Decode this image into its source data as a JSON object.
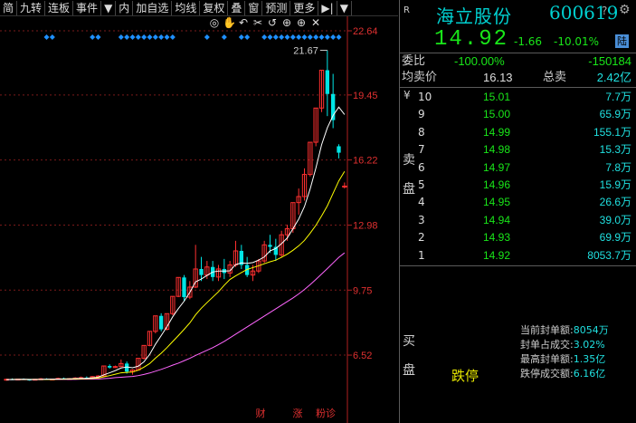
{
  "toolbar": {
    "items": [
      "简",
      "九转",
      "连板",
      "事件",
      "▼",
      "内",
      "加自选",
      "均线",
      "复权",
      "叠",
      "窗",
      "预测",
      "更多",
      "▶|",
      "▼"
    ]
  },
  "chart_tools": [
    "◎",
    "✋",
    "↶",
    "✂",
    "↺",
    "⊕",
    "⊕",
    "✕"
  ],
  "chart_data": {
    "type": "candlestick",
    "y_axis_ticks": [
      "22.64",
      "19.45",
      "16.22",
      "12.98",
      "9.75",
      "6.52"
    ],
    "ylim": [
      4.0,
      22.64
    ],
    "high_label": "21.67",
    "bottom_marks": [
      "财",
      "涨",
      "粉诊"
    ],
    "colors": {
      "up": "#ff3030",
      "down": "#00e5e5",
      "ma5": "#ffffff",
      "ma10": "#ffff00",
      "ma20": "#ff66ff",
      "signal": "#1e90ff"
    },
    "candles": [
      [
        5.3,
        5.35,
        5.25,
        5.32
      ],
      [
        5.32,
        5.36,
        5.28,
        5.3
      ],
      [
        5.3,
        5.34,
        5.26,
        5.33
      ],
      [
        5.33,
        5.36,
        5.29,
        5.3
      ],
      [
        5.3,
        5.33,
        5.25,
        5.28
      ],
      [
        5.28,
        5.34,
        5.27,
        5.32
      ],
      [
        5.32,
        5.38,
        5.3,
        5.34
      ],
      [
        5.34,
        5.37,
        5.3,
        5.31
      ],
      [
        5.31,
        5.35,
        5.28,
        5.33
      ],
      [
        5.33,
        5.4,
        5.32,
        5.36
      ],
      [
        5.36,
        5.4,
        5.31,
        5.33
      ],
      [
        5.33,
        5.38,
        5.3,
        5.35
      ],
      [
        5.35,
        5.42,
        5.33,
        5.38
      ],
      [
        5.38,
        5.45,
        5.36,
        5.4
      ],
      [
        5.4,
        5.46,
        5.37,
        5.39
      ],
      [
        5.39,
        5.48,
        5.38,
        5.45
      ],
      [
        5.45,
        5.52,
        5.43,
        5.48
      ],
      [
        5.48,
        5.98,
        5.47,
        5.98
      ],
      [
        5.98,
        6.06,
        5.85,
        5.9
      ],
      [
        5.9,
        6.0,
        5.88,
        5.95
      ],
      [
        5.95,
        6.3,
        5.93,
        6.1
      ],
      [
        6.1,
        6.2,
        5.6,
        5.7
      ],
      [
        5.7,
        5.82,
        5.55,
        5.78
      ],
      [
        5.78,
        6.36,
        5.76,
        6.36
      ],
      [
        6.36,
        7.0,
        6.3,
        7.0
      ],
      [
        7.0,
        7.7,
        6.96,
        7.7
      ],
      [
        7.7,
        8.47,
        7.6,
        8.47
      ],
      [
        8.47,
        8.6,
        7.7,
        7.8
      ],
      [
        7.8,
        8.58,
        7.75,
        8.58
      ],
      [
        8.58,
        9.44,
        8.5,
        9.44
      ],
      [
        9.44,
        10.38,
        9.4,
        10.38
      ],
      [
        10.38,
        10.5,
        9.2,
        9.4
      ],
      [
        9.4,
        10.2,
        9.3,
        9.9
      ],
      [
        9.9,
        12.0,
        9.85,
        10.8
      ],
      [
        10.8,
        11.4,
        10.2,
        10.5
      ],
      [
        10.5,
        11.2,
        10.3,
        10.9
      ],
      [
        10.9,
        11.2,
        10.2,
        10.4
      ],
      [
        10.4,
        11.0,
        10.2,
        10.8
      ],
      [
        10.8,
        11.3,
        10.3,
        10.6
      ],
      [
        10.6,
        11.2,
        10.4,
        11.0
      ],
      [
        11.0,
        12.2,
        10.9,
        11.7
      ],
      [
        11.7,
        12.0,
        10.8,
        11.0
      ],
      [
        11.0,
        11.4,
        10.4,
        10.5
      ],
      [
        10.5,
        11.0,
        10.2,
        10.7
      ],
      [
        10.7,
        11.3,
        10.6,
        11.2
      ],
      [
        11.2,
        12.2,
        11.1,
        12.0
      ],
      [
        12.0,
        12.5,
        11.6,
        11.9
      ],
      [
        11.9,
        12.3,
        11.2,
        11.5
      ],
      [
        11.5,
        12.7,
        11.4,
        12.5
      ],
      [
        12.5,
        13.0,
        12.2,
        12.8
      ],
      [
        12.8,
        14.1,
        12.6,
        14.1
      ],
      [
        14.1,
        14.8,
        13.5,
        14.4
      ],
      [
        14.4,
        15.8,
        14.2,
        15.5
      ],
      [
        15.5,
        17.1,
        15.4,
        17.1
      ],
      [
        17.1,
        18.8,
        16.9,
        18.8
      ],
      [
        18.8,
        20.68,
        18.6,
        20.68
      ],
      [
        20.68,
        21.67,
        18.4,
        19.5
      ],
      [
        19.5,
        20.5,
        17.8,
        18.2
      ],
      [
        16.9,
        17.0,
        16.3,
        16.58
      ],
      [
        14.92,
        15.1,
        14.8,
        14.92
      ]
    ],
    "ma5": [
      5.3,
      5.31,
      5.31,
      5.32,
      5.31,
      5.31,
      5.31,
      5.32,
      5.32,
      5.33,
      5.34,
      5.34,
      5.35,
      5.36,
      5.37,
      5.39,
      5.42,
      5.54,
      5.64,
      5.75,
      5.88,
      5.93,
      5.89,
      5.97,
      6.19,
      6.56,
      7.06,
      7.49,
      7.93,
      8.42,
      8.83,
      9.2,
      9.64,
      10.16,
      10.3,
      10.48,
      10.65,
      10.7,
      10.7,
      10.71,
      11.02,
      11.1,
      11.08,
      11.12,
      11.24,
      11.4,
      11.7,
      11.82,
      12.06,
      12.34,
      12.8,
      13.28,
      13.9,
      14.78,
      15.82,
      16.98,
      17.82,
      18.43,
      18.85,
      18.48
    ],
    "ma10": [
      5.3,
      5.31,
      5.31,
      5.31,
      5.31,
      5.31,
      5.31,
      5.31,
      5.31,
      5.32,
      5.32,
      5.33,
      5.33,
      5.34,
      5.35,
      5.36,
      5.38,
      5.44,
      5.5,
      5.57,
      5.64,
      5.66,
      5.68,
      5.77,
      5.92,
      6.1,
      6.37,
      6.61,
      6.89,
      7.19,
      7.49,
      7.8,
      8.12,
      8.52,
      8.85,
      9.13,
      9.4,
      9.67,
      9.99,
      10.28,
      10.46,
      10.62,
      10.78,
      10.87,
      10.96,
      11.06,
      11.16,
      11.24,
      11.38,
      11.54,
      11.73,
      11.95,
      12.22,
      12.58,
      12.97,
      13.44,
      13.94,
      14.56,
      15.18,
      15.65
    ],
    "ma20": [
      5.3,
      5.3,
      5.3,
      5.3,
      5.3,
      5.3,
      5.31,
      5.31,
      5.31,
      5.31,
      5.31,
      5.31,
      5.31,
      5.32,
      5.32,
      5.32,
      5.33,
      5.35,
      5.37,
      5.4,
      5.42,
      5.44,
      5.46,
      5.5,
      5.56,
      5.63,
      5.72,
      5.81,
      5.91,
      6.02,
      6.12,
      6.24,
      6.36,
      6.5,
      6.63,
      6.76,
      6.89,
      7.04,
      7.2,
      7.38,
      7.56,
      7.74,
      7.92,
      8.1,
      8.28,
      8.46,
      8.64,
      8.82,
      9.0,
      9.18,
      9.36,
      9.56,
      9.78,
      10.02,
      10.28,
      10.55,
      10.82,
      11.1,
      11.38,
      11.6
    ],
    "signal_indices": [
      7,
      8,
      15,
      16,
      20,
      21,
      22,
      23,
      24,
      25,
      26,
      27,
      28,
      29,
      35,
      38,
      41,
      42,
      45,
      46,
      47,
      48,
      49,
      50,
      51,
      52,
      53,
      54,
      55,
      56,
      57,
      58
    ]
  },
  "stock": {
    "badge": "R",
    "name": "海立股份",
    "code": "600619",
    "help": "?",
    "price": "14.92",
    "change": "-1.66",
    "change_pct": "-10.01%",
    "board": "陆"
  },
  "summary": {
    "weibi_label": "委比",
    "weibi_value": "-100.00%",
    "weicha_value": "-150184",
    "junmaijia_label": "均卖价",
    "junmaijia_value": "16.13",
    "zongmai_label": "总卖",
    "zongmai_value": "2.42亿"
  },
  "sell_label": "卖盘",
  "buy_label": "买盘",
  "orderbook": [
    {
      "n": "10",
      "price": "15.01",
      "vol": "7.7万"
    },
    {
      "n": "9",
      "price": "15.00",
      "vol": "65.9万"
    },
    {
      "n": "8",
      "price": "14.99",
      "vol": "155.1万"
    },
    {
      "n": "7",
      "price": "14.98",
      "vol": "15.3万"
    },
    {
      "n": "6",
      "price": "14.97",
      "vol": "7.8万"
    },
    {
      "n": "5",
      "price": "14.96",
      "vol": "15.9万"
    },
    {
      "n": "4",
      "price": "14.95",
      "vol": "26.6万"
    },
    {
      "n": "3",
      "price": "14.94",
      "vol": "39.0万"
    },
    {
      "n": "2",
      "price": "14.93",
      "vol": "69.9万"
    },
    {
      "n": "1",
      "price": "14.92",
      "vol": "8053.7万"
    }
  ],
  "yen": "¥",
  "limit_down_label": "跌停",
  "stats": [
    {
      "label": "当前封单额:",
      "value": "8054万"
    },
    {
      "label": "封单占成交:",
      "value": "3.02%"
    },
    {
      "label": "最高封单额:",
      "value": "1.35亿"
    },
    {
      "label": "跌停成交额:",
      "value": "6.16亿"
    }
  ]
}
